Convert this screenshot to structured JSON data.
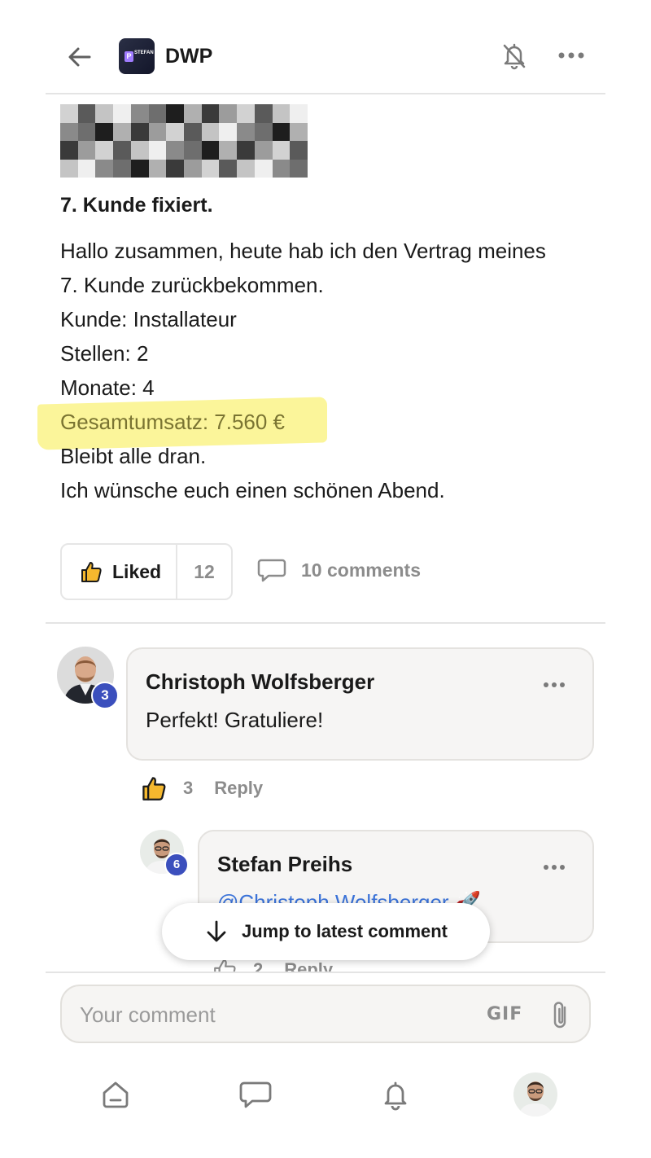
{
  "header": {
    "group_name": "DWP",
    "logo_letter": "P",
    "logo_text": "STEFAN",
    "back_icon": "arrow-left-icon",
    "bell_icon": "bell-off-icon",
    "more_icon": "more-horizontal-icon"
  },
  "post": {
    "title": "7. Kunde fixiert.",
    "lines": [
      "Hallo zusammen, heute hab ich den Vertrag meines",
      "7. Kunde zurückbekommen.",
      "Kunde: Installateur",
      "Stellen: 2",
      "Monate: 4",
      "Gesamtumsatz: 7.560 €",
      "Bleibt alle dran.",
      "Ich wünsche euch einen schönen Abend."
    ],
    "like_label": "Liked",
    "like_count": "12",
    "comments_label": "10 comments"
  },
  "comments": [
    {
      "author": "Christoph Wolfsberger",
      "text": "Perfekt! Gratuliere!",
      "badge": "3",
      "likes": "3",
      "reply_label": "Reply"
    },
    {
      "author": "Stefan Preihs",
      "mention": "@Christoph Wolfsberger",
      "emoji": "🚀",
      "badge": "6",
      "likes": "2",
      "reply_label": "Reply"
    }
  ],
  "jump_label": "Jump to latest comment",
  "composer": {
    "placeholder": "Your comment",
    "gif_label": "GIF"
  },
  "bottom_nav": [
    "home-icon",
    "chat-icon",
    "notifications-icon",
    "profile-avatar"
  ],
  "colors": {
    "highlight": "#fbf59a",
    "badge": "#3b4fbd",
    "mention": "#3b73d9",
    "like_thumb": "#f5b82e"
  }
}
